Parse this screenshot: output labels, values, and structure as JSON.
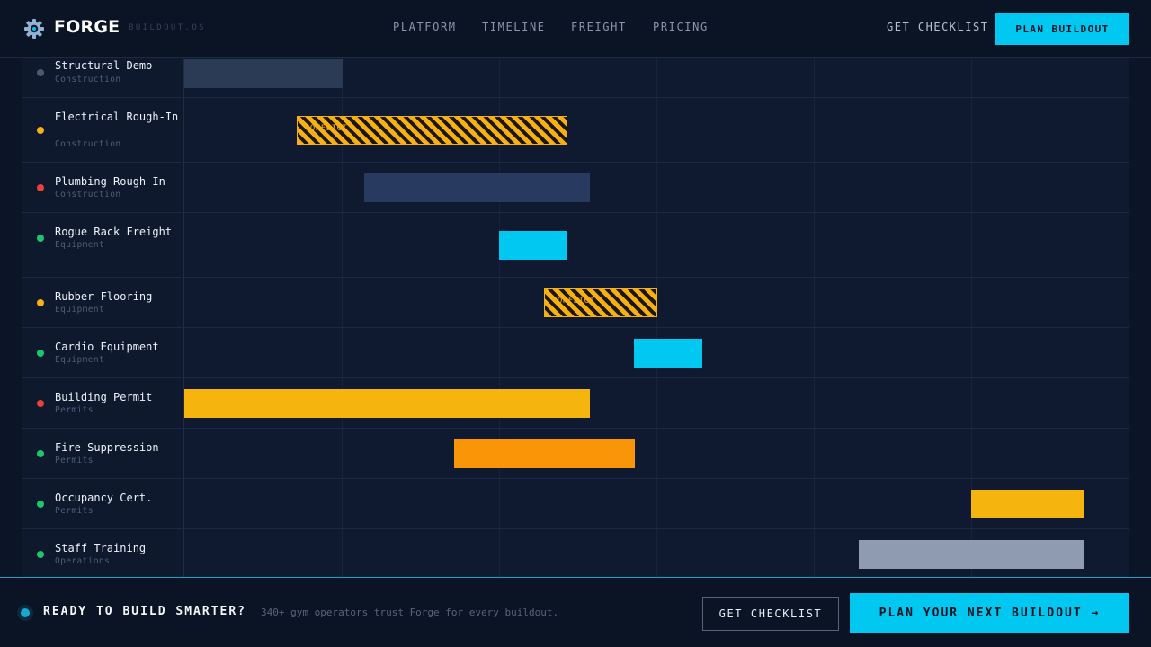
{
  "header": {
    "brand": "FORGE",
    "brand_sub": "BUILDOUT.OS",
    "nav": [
      "PLATFORM",
      "TIMELINE",
      "FREIGHT",
      "PRICING"
    ],
    "checklist_label": "GET CHECKLIST",
    "cta_label": "PLAN BUILDOUT"
  },
  "gantt": {
    "tasks": [
      {
        "name": "Structural Demo",
        "category": "Construction",
        "status_color": "#4b5a70",
        "bar_color": "#2c3b55",
        "style": "solid",
        "bar_label": ""
      },
      {
        "name": "Electrical Rough-In",
        "category": "Construction",
        "status_color": "#f6b012",
        "bar_color": "#f6b012",
        "style": "hatch",
        "bar_label": "CONFLICT"
      },
      {
        "name": "Plumbing Rough-In",
        "category": "Construction",
        "status_color": "#e5433b",
        "bar_color": "#283a5f",
        "style": "solid",
        "bar_label": ""
      },
      {
        "name": "Rogue Rack Freight",
        "category": "Equipment",
        "status_color": "#19c76e",
        "bar_color": "#00c8f0",
        "style": "solid",
        "bar_label": ""
      },
      {
        "name": "Rubber Flooring",
        "category": "Equipment",
        "status_color": "#f6b012",
        "bar_color": "#f6b012",
        "style": "hatch",
        "bar_label": "CONFLICT"
      },
      {
        "name": "Cardio Equipment",
        "category": "Equipment",
        "status_color": "#19c76e",
        "bar_color": "#00c8f0",
        "style": "solid",
        "bar_label": ""
      },
      {
        "name": "Building Permit",
        "category": "Permits",
        "status_color": "#e5433b",
        "bar_color": "#f6b40e",
        "style": "solid",
        "bar_label": ""
      },
      {
        "name": "Fire Suppression",
        "category": "Permits",
        "status_color": "#19c76e",
        "bar_color": "#fb9508",
        "style": "solid",
        "bar_label": ""
      },
      {
        "name": "Occupancy Cert.",
        "category": "Permits",
        "status_color": "#19c76e",
        "bar_color": "#f6b40e",
        "style": "solid",
        "bar_label": ""
      },
      {
        "name": "Staff Training",
        "category": "Operations",
        "status_color": "#19c76e",
        "bar_color": "#8e9bb1",
        "style": "solid",
        "bar_label": ""
      }
    ]
  },
  "footer": {
    "headline": "READY TO BUILD SMARTER?",
    "trust": "340+ gym operators trust Forge for every buildout.",
    "checklist_label": "GET CHECKLIST",
    "cta_label": "PLAN YOUR NEXT BUILDOUT →"
  }
}
